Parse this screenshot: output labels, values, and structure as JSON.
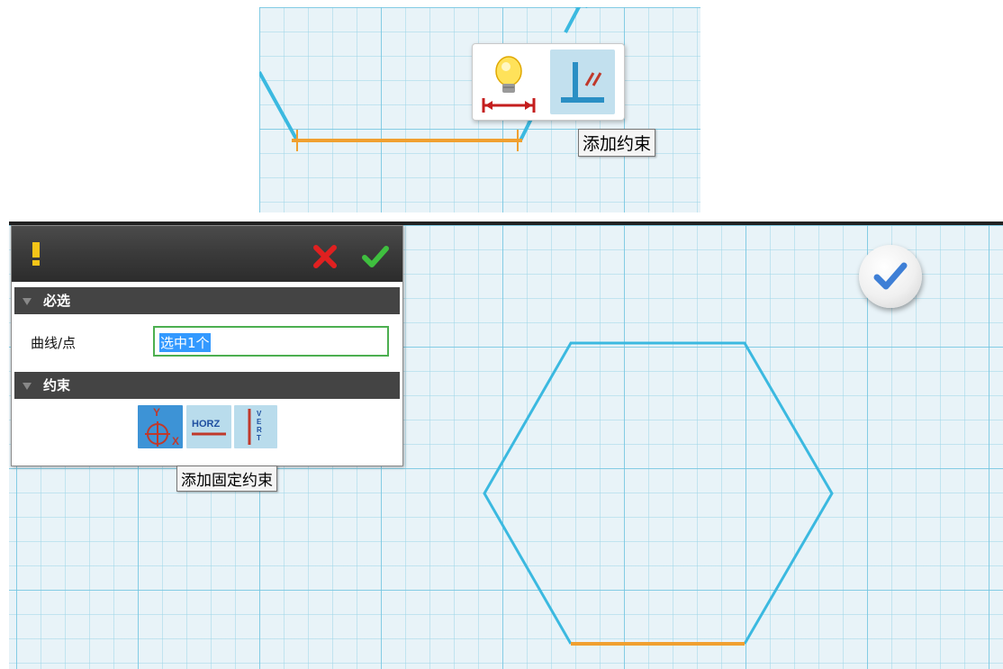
{
  "top_inset": {
    "tooltip": "添加约束",
    "toolbar": {
      "smart_dimension_icon": "lightbulb-dimension-icon",
      "add_constraint_icon": "perpendicular-constraint-icon"
    }
  },
  "dialog": {
    "header_icon": "warning-icon",
    "cancel_icon": "red-x-icon",
    "ok_icon": "green-check-icon",
    "sections": {
      "required": {
        "title": "必选",
        "field_label": "曲线/点",
        "field_value": "选中1个"
      },
      "constraint": {
        "title": "约束",
        "buttons": {
          "fixed": "添加固定约束",
          "horz_text": "HORZ",
          "vert_text": "VERT"
        }
      }
    }
  },
  "tooltip_fixed": "添加固定约束",
  "colors": {
    "grid_bg": "#e8f3f8",
    "sketch_line": "#3bb9e0",
    "selected_line": "#f0a030",
    "selection_highlight": "#3399ff",
    "field_border": "#4caf50"
  }
}
